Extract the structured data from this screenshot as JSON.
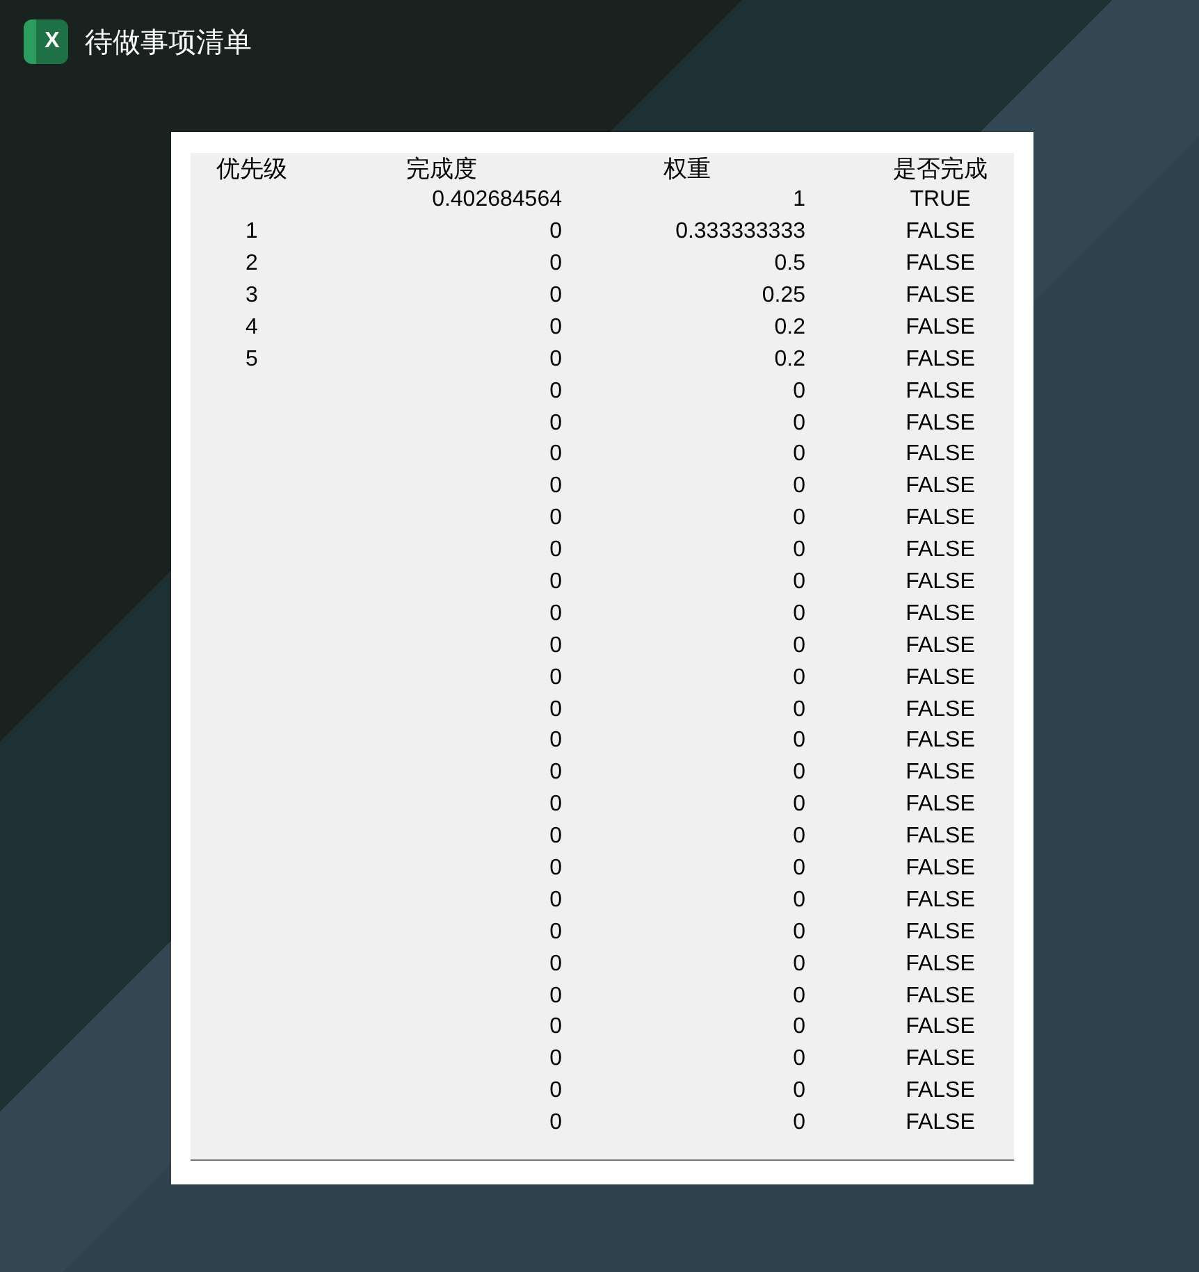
{
  "window": {
    "title": "待做事项清单",
    "app_icon_letter": "X"
  },
  "sheet": {
    "columns": [
      "优先级",
      "完成度",
      "权重",
      "是否完成"
    ],
    "rows": [
      {
        "priority": "",
        "completion": "0.402684564",
        "weight": "1",
        "done": "TRUE"
      },
      {
        "priority": "1",
        "completion": "0",
        "weight": "0.333333333",
        "done": "FALSE"
      },
      {
        "priority": "2",
        "completion": "0",
        "weight": "0.5",
        "done": "FALSE"
      },
      {
        "priority": "3",
        "completion": "0",
        "weight": "0.25",
        "done": "FALSE"
      },
      {
        "priority": "4",
        "completion": "0",
        "weight": "0.2",
        "done": "FALSE"
      },
      {
        "priority": "5",
        "completion": "0",
        "weight": "0.2",
        "done": "FALSE"
      },
      {
        "priority": "",
        "completion": "0",
        "weight": "0",
        "done": "FALSE"
      },
      {
        "priority": "",
        "completion": "0",
        "weight": "0",
        "done": "FALSE"
      },
      {
        "priority": "",
        "completion": "0",
        "weight": "0",
        "done": "FALSE"
      },
      {
        "priority": "",
        "completion": "0",
        "weight": "0",
        "done": "FALSE"
      },
      {
        "priority": "",
        "completion": "0",
        "weight": "0",
        "done": "FALSE"
      },
      {
        "priority": "",
        "completion": "0",
        "weight": "0",
        "done": "FALSE"
      },
      {
        "priority": "",
        "completion": "0",
        "weight": "0",
        "done": "FALSE"
      },
      {
        "priority": "",
        "completion": "0",
        "weight": "0",
        "done": "FALSE"
      },
      {
        "priority": "",
        "completion": "0",
        "weight": "0",
        "done": "FALSE"
      },
      {
        "priority": "",
        "completion": "0",
        "weight": "0",
        "done": "FALSE"
      },
      {
        "priority": "",
        "completion": "0",
        "weight": "0",
        "done": "FALSE"
      },
      {
        "priority": "",
        "completion": "0",
        "weight": "0",
        "done": "FALSE"
      },
      {
        "priority": "",
        "completion": "0",
        "weight": "0",
        "done": "FALSE"
      },
      {
        "priority": "",
        "completion": "0",
        "weight": "0",
        "done": "FALSE"
      },
      {
        "priority": "",
        "completion": "0",
        "weight": "0",
        "done": "FALSE"
      },
      {
        "priority": "",
        "completion": "0",
        "weight": "0",
        "done": "FALSE"
      },
      {
        "priority": "",
        "completion": "0",
        "weight": "0",
        "done": "FALSE"
      },
      {
        "priority": "",
        "completion": "0",
        "weight": "0",
        "done": "FALSE"
      },
      {
        "priority": "",
        "completion": "0",
        "weight": "0",
        "done": "FALSE"
      },
      {
        "priority": "",
        "completion": "0",
        "weight": "0",
        "done": "FALSE"
      },
      {
        "priority": "",
        "completion": "0",
        "weight": "0",
        "done": "FALSE"
      },
      {
        "priority": "",
        "completion": "0",
        "weight": "0",
        "done": "FALSE"
      },
      {
        "priority": "",
        "completion": "0",
        "weight": "0",
        "done": "FALSE"
      },
      {
        "priority": "",
        "completion": "0",
        "weight": "0",
        "done": "FALSE"
      }
    ]
  }
}
